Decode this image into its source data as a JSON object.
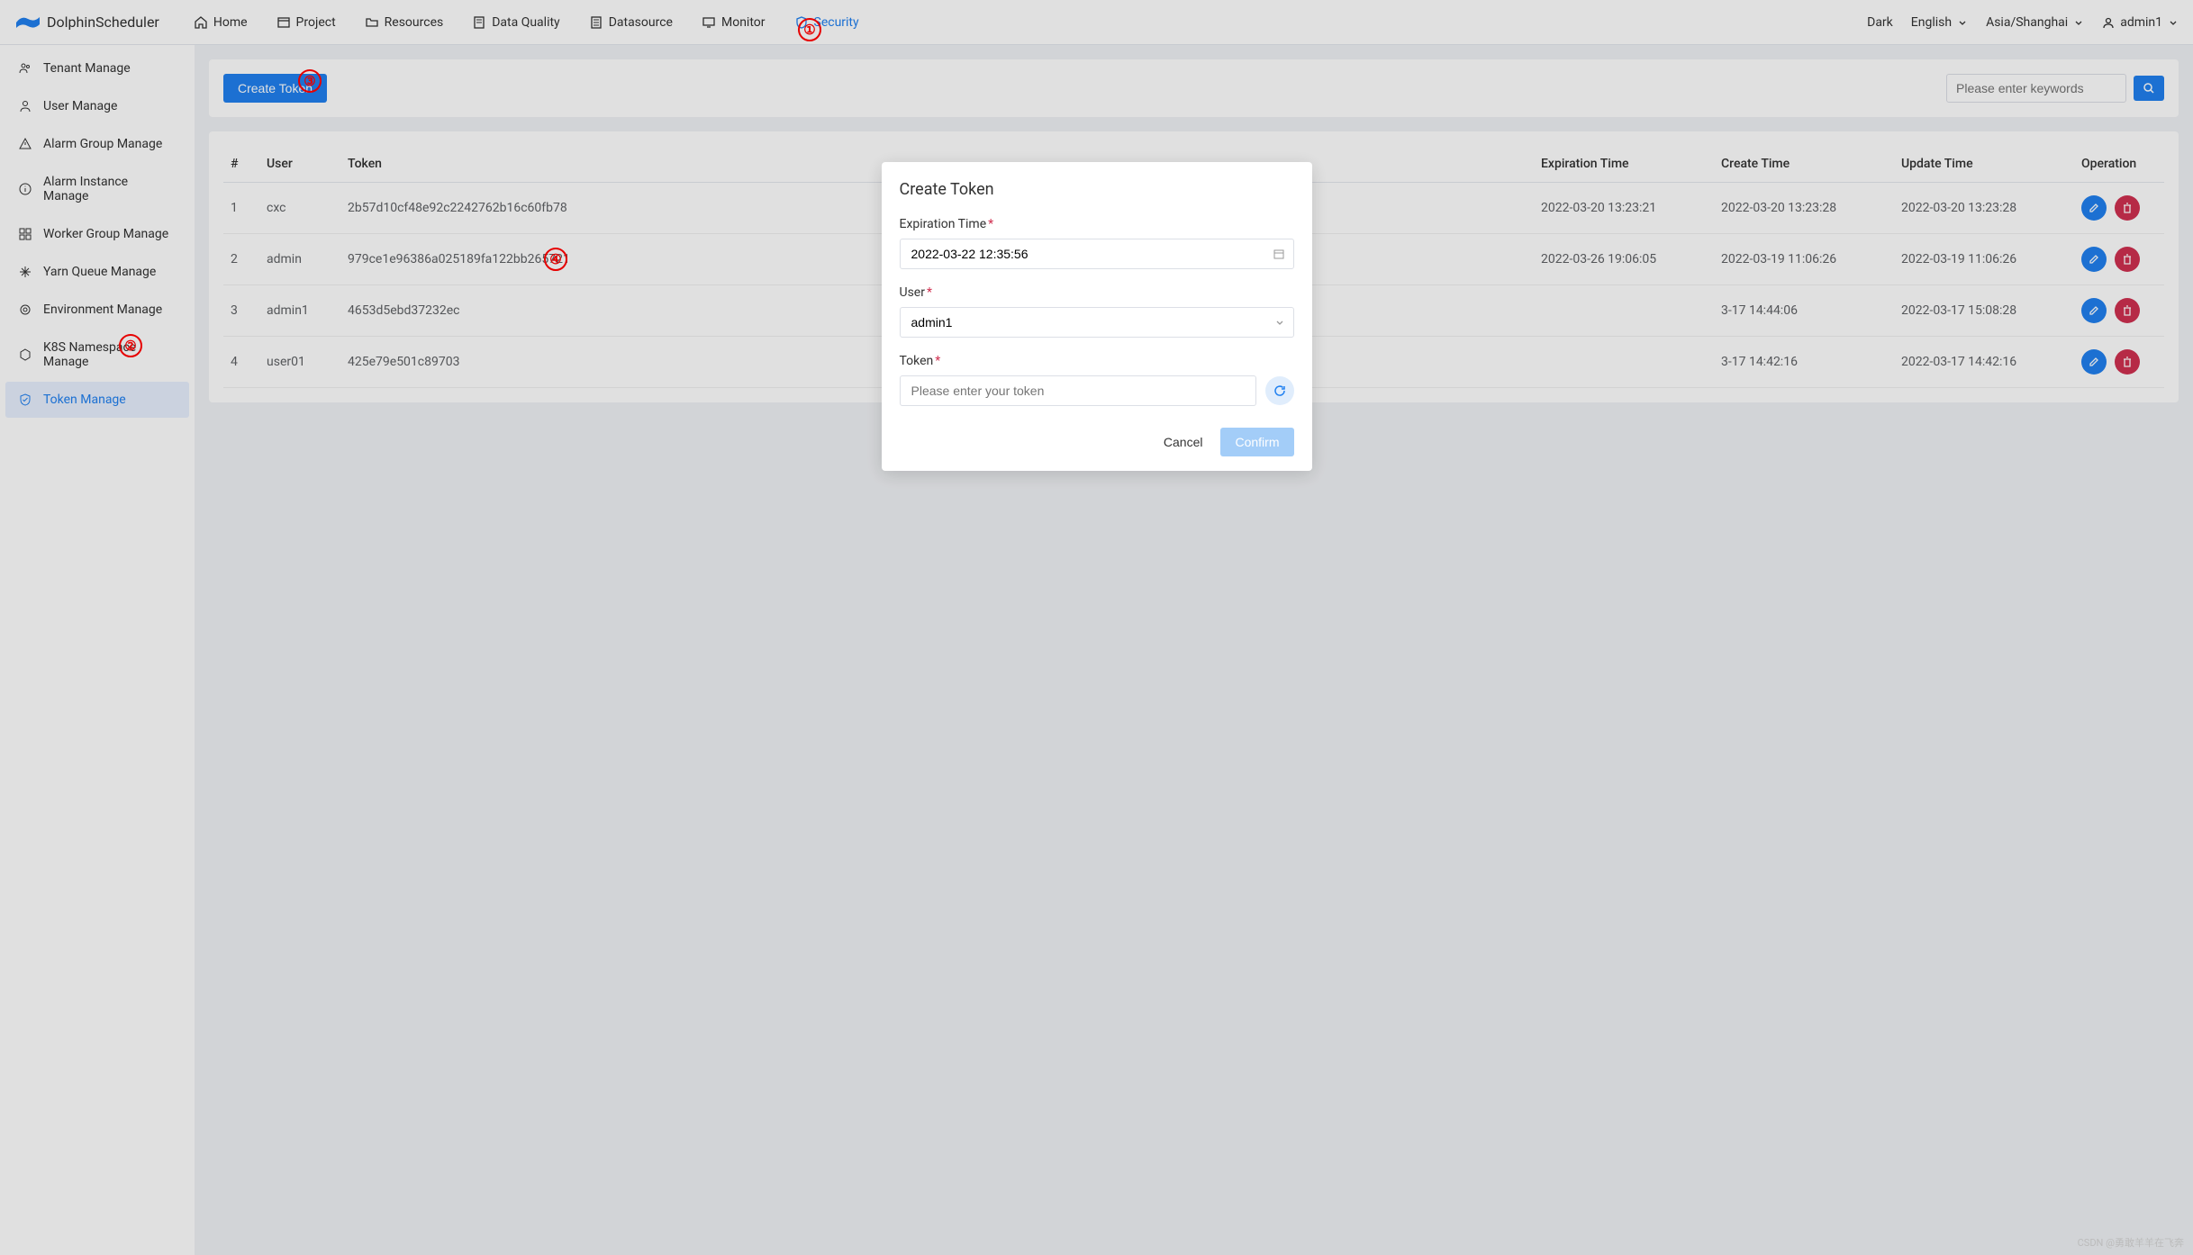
{
  "brand": "DolphinScheduler",
  "topnav": {
    "items": [
      {
        "label": "Home"
      },
      {
        "label": "Project"
      },
      {
        "label": "Resources"
      },
      {
        "label": "Data Quality"
      },
      {
        "label": "Datasource"
      },
      {
        "label": "Monitor"
      },
      {
        "label": "Security",
        "active": true
      }
    ],
    "right": {
      "theme": "Dark",
      "lang": "English",
      "tz": "Asia/Shanghai",
      "user": "admin1"
    }
  },
  "sidebar": {
    "items": [
      {
        "label": "Tenant Manage"
      },
      {
        "label": "User Manage"
      },
      {
        "label": "Alarm Group Manage"
      },
      {
        "label": "Alarm Instance Manage"
      },
      {
        "label": "Worker Group Manage"
      },
      {
        "label": "Yarn Queue Manage"
      },
      {
        "label": "Environment Manage"
      },
      {
        "label": "K8S Namespace Manage"
      },
      {
        "label": "Token Manage",
        "active": true
      }
    ]
  },
  "toolbar": {
    "create_label": "Create Token",
    "search_placeholder": "Please enter keywords"
  },
  "table": {
    "headers": {
      "idx": "#",
      "user": "User",
      "token": "Token",
      "exp": "Expiration Time",
      "create": "Create Time",
      "update": "Update Time",
      "op": "Operation"
    },
    "rows": [
      {
        "idx": "1",
        "user": "cxc",
        "token": "2b57d10cf48e92c2242762b16c60fb78",
        "exp": "2022-03-20 13:23:21",
        "create": "2022-03-20 13:23:28",
        "update": "2022-03-20 13:23:28"
      },
      {
        "idx": "2",
        "user": "admin",
        "token": "979ce1e96386a025189fa122bb265721",
        "exp": "2022-03-26 19:06:05",
        "create": "2022-03-19 11:06:26",
        "update": "2022-03-19 11:06:26"
      },
      {
        "idx": "3",
        "user": "admin1",
        "token": "4653d5ebd37232ec",
        "exp": "",
        "create": "3-17 14:44:06",
        "update": "2022-03-17 15:08:28"
      },
      {
        "idx": "4",
        "user": "user01",
        "token": "425e79e501c89703",
        "exp": "",
        "create": "3-17 14:42:16",
        "update": "2022-03-17 14:42:16"
      }
    ]
  },
  "modal": {
    "title": "Create Token",
    "exp_label": "Expiration Time",
    "exp_value": "2022-03-22 12:35:56",
    "user_label": "User",
    "user_value": "admin1",
    "token_label": "Token",
    "token_placeholder": "Please enter your token",
    "cancel": "Cancel",
    "confirm": "Confirm"
  },
  "annotations": [
    "①",
    "②",
    "③",
    "④"
  ],
  "watermark": "CSDN @勇敢羊羊在飞奔"
}
